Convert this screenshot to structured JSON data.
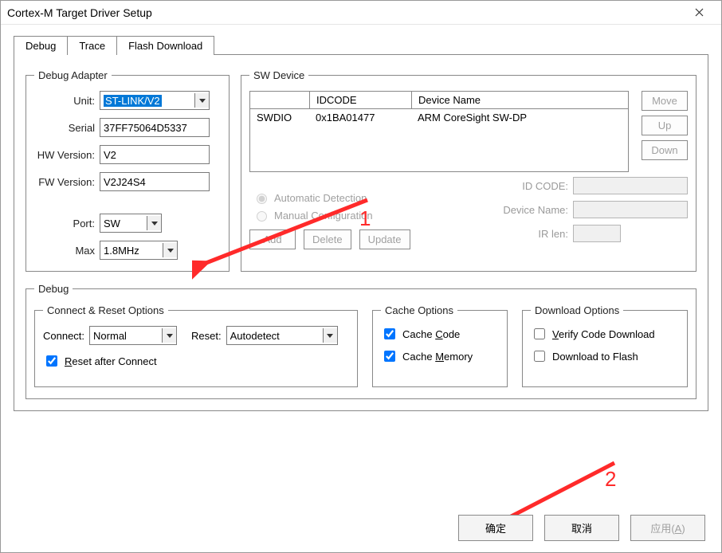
{
  "window": {
    "title": "Cortex-M Target Driver Setup"
  },
  "tabs": [
    {
      "label": "Debug",
      "active": true
    },
    {
      "label": "Trace",
      "active": false
    },
    {
      "label": "Flash Download",
      "active": false
    }
  ],
  "debug_adapter": {
    "legend": "Debug Adapter",
    "unit_label": "Unit:",
    "unit_value": "ST-LINK/V2",
    "serial_label": "Serial",
    "serial_value": "37FF75064D5337",
    "hw_label": "HW Version:",
    "hw_value": "V2",
    "fw_label": "FW Version:",
    "fw_value": "V2J24S4",
    "port_label": "Port:",
    "port_value": "SW",
    "max_label": "Max",
    "max_value": "1.8MHz"
  },
  "sw_device": {
    "legend": "SW Device",
    "col_idcode": "IDCODE",
    "col_devname": "Device Name",
    "row_label": "SWDIO",
    "rows": [
      {
        "idcode": "0x1BA01477",
        "name": "ARM CoreSight SW-DP"
      }
    ],
    "btn_move": "Move",
    "btn_up": "Up",
    "btn_down": "Down",
    "radio_auto": "Automatic Detection",
    "radio_manual": "Manual Configuration",
    "idcode_label": "ID CODE:",
    "devname_label": "Device Name:",
    "irlen_label": "IR len:",
    "btn_add": "Add",
    "btn_delete": "Delete",
    "btn_update": "Update"
  },
  "debug_group": {
    "legend": "Debug",
    "connect_reset": {
      "legend": "Connect & Reset Options",
      "connect_label": "Connect:",
      "connect_value": "Normal",
      "reset_label": "Reset:",
      "reset_value": "Autodetect",
      "reset_after_connect": "eset after Connect",
      "reset_after_connect_prefix": "R"
    },
    "cache": {
      "legend": "Cache Options",
      "code": "ode",
      "code_prefix": "Cache ",
      "code_underline": "C",
      "memory": "emory",
      "memory_prefix": "Cache ",
      "memory_underline": "M"
    },
    "download": {
      "legend": "Download Options",
      "verify": "erify Code Download",
      "verify_underline": "V",
      "toflash": "Download to Flash"
    }
  },
  "buttons": {
    "ok": "确定",
    "cancel": "取消",
    "apply": "应用(A)"
  },
  "annotations": {
    "one": "1",
    "two": "2"
  }
}
